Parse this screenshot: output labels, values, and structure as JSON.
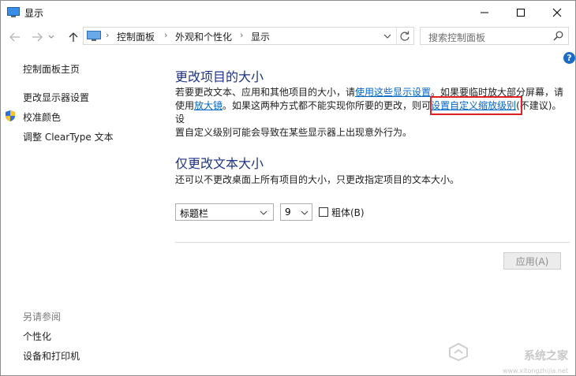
{
  "window": {
    "title": "显示",
    "minimize_icon": "minimize-icon",
    "maximize_icon": "maximize-icon",
    "close_icon": "close-icon"
  },
  "address_bar": {
    "breadcrumbs": [
      "控制面板",
      "外观和个性化",
      "显示"
    ],
    "search_placeholder": "搜索控制面板"
  },
  "sidebar": {
    "links": [
      "控制面板主页",
      "更改显示器设置",
      "校准颜色",
      "调整 ClearType 文本"
    ],
    "see_also_heading": "另请参阅",
    "see_also_links": [
      "个性化",
      "设备和打印机"
    ]
  },
  "main": {
    "section1_title": "更改项目的大小",
    "section1_text_a": "若要更改文本、应用和其他项目的大小，请",
    "section1_link_a": "使用这些显示设置",
    "section1_text_b": "。如果要临时放大部分屏幕，请",
    "section1_text_c": "使用",
    "section1_link_b": "放大镜",
    "section1_text_d": "。如果这两种方式都不能实现你所要的更改，则可",
    "section1_link_c": "设置自定义缩放级别",
    "section1_text_e": "(不建议)。设",
    "section1_text_f": "置自定义级别可能会导致在某些显示器上出现意外行为。",
    "section2_title": "仅更改文本大小",
    "section2_text": "还可以不更改桌面上所有项目的大小，只更改指定项目的文本大小。",
    "item_select": "标题栏",
    "size_select": "9",
    "bold_label": "粗体(B)",
    "bold_checked": false,
    "apply_label": "应用(A)"
  },
  "watermark": {
    "text": "系统之家",
    "url": "www.xitongzhijia.net"
  },
  "colors": {
    "heading": "#1e3287",
    "link": "#0066cc",
    "highlight_box": "#e02020",
    "help_icon": "#1c6cc7"
  }
}
